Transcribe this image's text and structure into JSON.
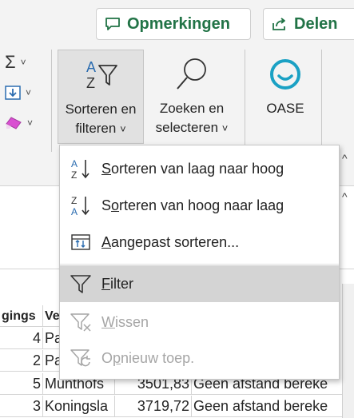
{
  "header": {
    "comments_label": "Opmerkingen",
    "share_label": "Delen",
    "brand_color": "#217346"
  },
  "ribbon": {
    "sort_filter": {
      "line1": "Sorteren en",
      "line2": "filteren",
      "chevron": "˅"
    },
    "find_select": {
      "line1": "Zoeken en",
      "line2": "selecteren",
      "chevron": "˅"
    },
    "oase": {
      "label": "OASE"
    },
    "chevron_right": "^"
  },
  "menu": {
    "items": [
      {
        "key": "S",
        "rest": "orteren van laag naar hoog",
        "icon": "sort-ascending-icon",
        "state": "normal"
      },
      {
        "pre": "S",
        "key": "o",
        "rest": "rteren van hoog naar laag",
        "icon": "sort-descending-icon",
        "state": "normal"
      },
      {
        "key": "A",
        "rest": "angepast sorteren...",
        "icon": "custom-sort-icon",
        "state": "normal"
      },
      {
        "key": "F",
        "rest": "ilter",
        "icon": "filter-icon",
        "state": "highlight"
      },
      {
        "key": "W",
        "rest": "issen",
        "icon": "clear-filter-icon",
        "state": "disabled"
      },
      {
        "pre": "O",
        "key": "p",
        "rest": "nieuw toep.",
        "icon": "reapply-filter-icon",
        "state": "disabled"
      }
    ]
  },
  "sheet": {
    "header_frag1": "gings",
    "header_frag2": "Ve",
    "rows": [
      {
        "num": "4",
        "name": "Pa",
        "value": "",
        "status": ""
      },
      {
        "num": "2",
        "name": "Pa",
        "value": "",
        "status": ""
      },
      {
        "num": "5",
        "name": "Munthofs",
        "value": "3501,83",
        "status": "Geen afstand bereke"
      },
      {
        "num": "3",
        "name": "Koningsla",
        "value": "3719,72",
        "status": "Geen afstand bereke"
      }
    ]
  }
}
